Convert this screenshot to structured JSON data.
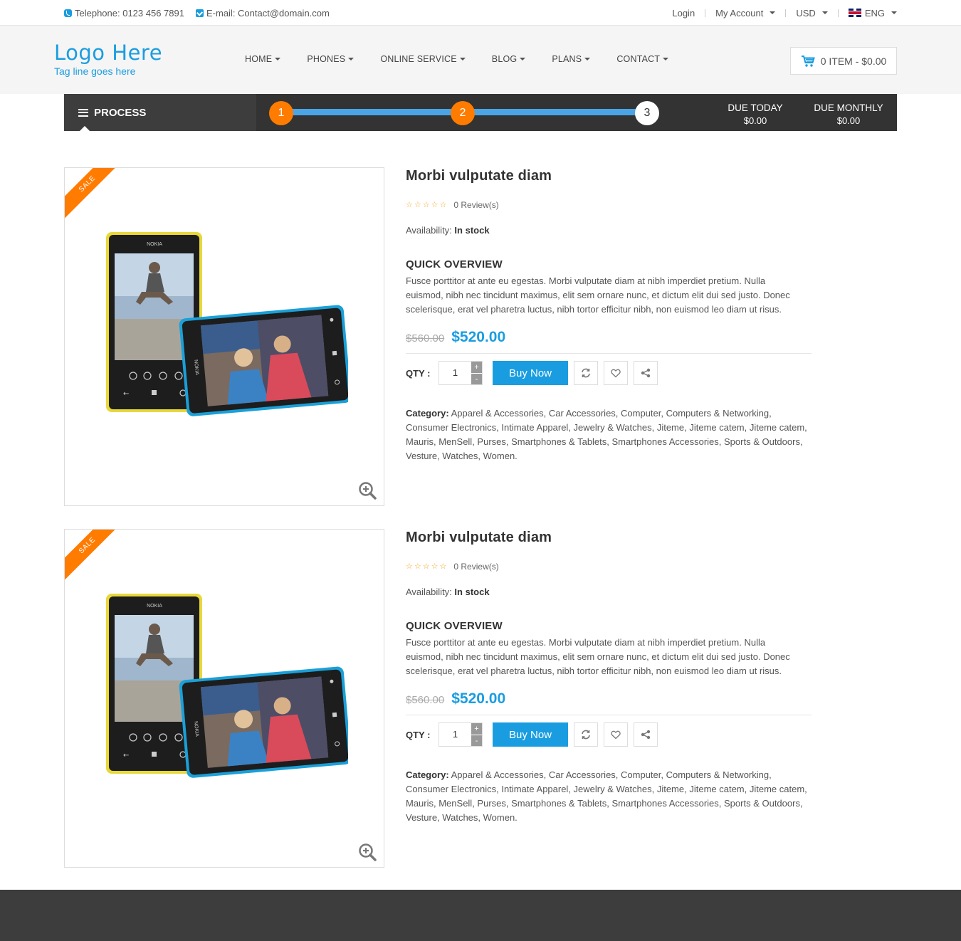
{
  "topbar": {
    "telephone": "Telephone: 0123 456 7891",
    "email": "E-mail: Contact@domain.com",
    "login": "Login",
    "account": "My Account",
    "currency": "USD",
    "language": "ENG"
  },
  "header": {
    "logo_name": "Logo Here",
    "logo_tagline": "Tag line goes here",
    "nav": [
      "HOME",
      "PHONES",
      "ONLINE SERVICE",
      "BLOG",
      "PLANS",
      "CONTACT"
    ],
    "cart": "0 ITEM - $0.00"
  },
  "process": {
    "label": "PROCESS",
    "steps": [
      "1",
      "2",
      "3"
    ],
    "due_today_label": "DUE TODAY",
    "due_today_value": "$0.00",
    "due_monthly_label": "DUE MONTHLY",
    "due_monthly_value": "$0.00"
  },
  "products": [
    {
      "badge": "SALE",
      "title": "Morbi vulputate diam",
      "reviews": "0 Review(s)",
      "rating": 0,
      "availability_label": "Availability:",
      "availability_value": "In stock",
      "overview_title": "QUICK OVERVIEW",
      "overview_text": "Fusce porttitor at ante eu egestas. Morbi vulputate diam at nibh imperdiet pretium. Nulla euismod, nibh nec tincidunt maximus, elit sem ornare nunc, et dictum elit dui sed justo. Donec scelerisque, erat vel pharetra luctus, nibh tortor efficitur nibh, non euismod leo diam ut risus.",
      "old_price": "$560.00",
      "new_price": "$520.00",
      "qty_label": "QTY :",
      "qty_value": "1",
      "buy_label": "Buy Now",
      "category_label": "Category:",
      "categories": "Apparel & Accessories, Car Accessories, Computer, Computers & Networking, Consumer Electronics, Intimate Apparel, Jewelry & Watches, Jiteme, Jiteme catem, Jiteme catem, Mauris, MenSell, Purses, Smartphones & Tablets, Smartphones Accessories, Sports & Outdoors, Vesture, Watches, Women."
    },
    {
      "badge": "SALE",
      "title": "Morbi vulputate diam",
      "reviews": "0 Review(s)",
      "rating": 0,
      "availability_label": "Availability:",
      "availability_value": "In stock",
      "overview_title": "QUICK OVERVIEW",
      "overview_text": "Fusce porttitor at ante eu egestas. Morbi vulputate diam at nibh imperdiet pretium. Nulla euismod, nibh nec tincidunt maximus, elit sem ornare nunc, et dictum elit dui sed justo. Donec scelerisque, erat vel pharetra luctus, nibh tortor efficitur nibh, non euismod leo diam ut risus.",
      "old_price": "$560.00",
      "new_price": "$520.00",
      "qty_label": "QTY :",
      "qty_value": "1",
      "buy_label": "Buy Now",
      "category_label": "Category:",
      "categories": "Apparel & Accessories, Car Accessories, Computer, Computers & Networking, Consumer Electronics, Intimate Apparel, Jewelry & Watches, Jiteme, Jiteme catem, Jiteme catem, Mauris, MenSell, Purses, Smartphones & Tablets, Smartphones Accessories, Sports & Outdoors, Vesture, Watches, Women."
    }
  ],
  "icons": {
    "phone": "phone-icon",
    "email": "mail-icon",
    "cart": "cart-icon",
    "process": "list-icon",
    "zoom": "zoom-in-icon",
    "compare": "refresh-icon",
    "wishlist": "heart-icon",
    "share": "share-icon"
  },
  "colors": {
    "accent": "#1a9de0",
    "orange": "#ff7c00",
    "dark": "#333333"
  }
}
